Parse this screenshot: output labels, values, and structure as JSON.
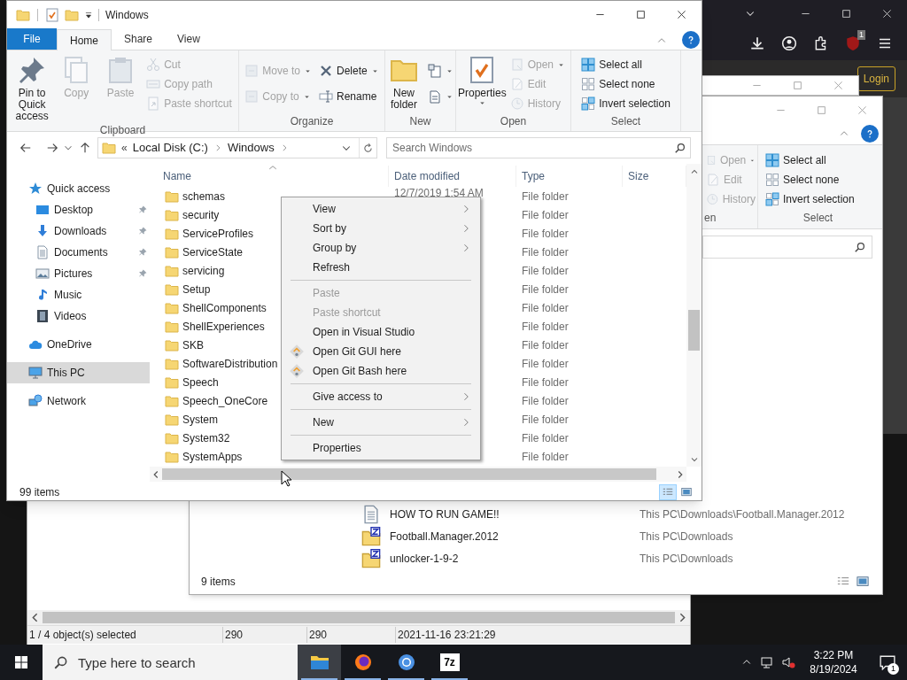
{
  "browser": {
    "login_button": "Login",
    "extension_badge": "1"
  },
  "back_window": {
    "status": [
      "1 / 4 object(s) selected",
      "290",
      "290",
      "2021-11-16 23:21:29"
    ]
  },
  "search_window": {
    "open_items": [
      {
        "label": "Open",
        "kind": "open",
        "disabled": true,
        "dropdown": true
      },
      {
        "label": "Edit",
        "kind": "edit",
        "disabled": true
      },
      {
        "label": "History",
        "kind": "history",
        "disabled": true
      }
    ],
    "group_labels": [
      "en",
      "Select"
    ],
    "select_items": [
      {
        "label": "Select all",
        "kind": "selectall"
      },
      {
        "label": "Select none",
        "kind": "selectnone"
      },
      {
        "label": "Invert selection",
        "kind": "invert"
      }
    ],
    "results": [
      {
        "name": "HOW TO RUN GAME!!",
        "location": "This PC\\Downloads\\Football.Manager.2012",
        "kind": "text"
      },
      {
        "name": "Football.Manager.2012",
        "location": "This PC\\Downloads",
        "kind": "archive"
      },
      {
        "name": "unlocker-1-9-2",
        "location": "This PC\\Downloads",
        "kind": "archive"
      }
    ],
    "status": "9 items"
  },
  "explorer": {
    "title": "Windows",
    "tabs": [
      {
        "label": "File",
        "kind": "file",
        "selected": false
      },
      {
        "label": "Home",
        "kind": "tab",
        "selected": true
      },
      {
        "label": "Share",
        "kind": "tab",
        "selected": false
      },
      {
        "label": "View",
        "kind": "tab",
        "selected": false
      }
    ],
    "ribbon": [
      {
        "label": "Clipboard",
        "columns": [
          {
            "kind": "large",
            "item": {
              "label": "Pin to Quick access",
              "kind": "pin",
              "disabled": false
            }
          },
          {
            "kind": "large",
            "item": {
              "label": "Copy",
              "kind": "copy",
              "disabled": true
            }
          },
          {
            "kind": "large",
            "item": {
              "label": "Paste",
              "kind": "paste",
              "disabled": true
            }
          },
          {
            "kind": "stack",
            "items": [
              {
                "label": "Cut",
                "kind": "cut",
                "disabled": true
              },
              {
                "label": "Copy path",
                "kind": "path",
                "disabled": true
              },
              {
                "label": "Paste shortcut",
                "kind": "shortcut",
                "disabled": true
              }
            ]
          }
        ]
      },
      {
        "label": "Organize",
        "columns": [
          {
            "kind": "stack",
            "items": [
              {
                "label": "Move to",
                "kind": "move",
                "disabled": true,
                "dropdown": true
              },
              {
                "label": "Copy to",
                "kind": "move",
                "disabled": true,
                "dropdown": true
              }
            ]
          },
          {
            "kind": "stack",
            "items": [
              {
                "label": "Delete",
                "kind": "delete",
                "disabled": false,
                "dropdown": true
              },
              {
                "label": "Rename",
                "kind": "rename",
                "disabled": false
              }
            ]
          }
        ]
      },
      {
        "label": "New",
        "columns": [
          {
            "kind": "large",
            "item": {
              "label": "New folder",
              "kind": "folder",
              "disabled": false
            }
          },
          {
            "kind": "stack",
            "items": [
              {
                "kind": "newitem",
                "disabled": false,
                "dropdown": true
              },
              {
                "kind": "easy",
                "disabled": false,
                "dropdown": true
              }
            ]
          }
        ]
      },
      {
        "label": "Open",
        "columns": [
          {
            "kind": "large",
            "item": {
              "label": "Properties",
              "kind": "properties",
              "disabled": false,
              "dropdown": true
            }
          },
          {
            "kind": "stack",
            "items": [
              {
                "label": "Open",
                "kind": "open",
                "disabled": true,
                "dropdown": true
              },
              {
                "label": "Edit",
                "kind": "edit",
                "disabled": true
              },
              {
                "label": "History",
                "kind": "history",
                "disabled": true
              }
            ]
          }
        ]
      },
      {
        "label": "Select",
        "columns": [
          {
            "kind": "stack",
            "items": [
              {
                "label": "Select all",
                "kind": "selectall",
                "disabled": false
              },
              {
                "label": "Select none",
                "kind": "selectnone",
                "disabled": false
              },
              {
                "label": "Invert selection",
                "kind": "invert",
                "disabled": false
              }
            ]
          }
        ]
      }
    ],
    "address": {
      "overflow": "«",
      "crumbs": [
        "Local Disk (C:)",
        "Windows"
      ]
    },
    "search": {
      "placeholder": "Search Windows"
    },
    "nav": [
      {
        "label": "Quick access",
        "kind": "star",
        "selected": false,
        "children": [
          {
            "label": "Desktop",
            "kind": "desktop",
            "pinned": true
          },
          {
            "label": "Downloads",
            "kind": "download",
            "pinned": true
          },
          {
            "label": "Documents",
            "kind": "document",
            "pinned": true
          },
          {
            "label": "Pictures",
            "kind": "picture",
            "pinned": true
          },
          {
            "label": "Music",
            "kind": "music",
            "pinned": false
          },
          {
            "label": "Videos",
            "kind": "video",
            "pinned": false
          }
        ]
      },
      {
        "label": "OneDrive",
        "kind": "cloud",
        "selected": false
      },
      {
        "label": "This PC",
        "kind": "pc",
        "selected": true
      },
      {
        "label": "Network",
        "kind": "network",
        "selected": false
      }
    ],
    "columns": [
      "Name",
      "Date modified",
      "Type",
      "Size"
    ],
    "rows": [
      {
        "name": "schemas",
        "date": "12/7/2019 1:54 AM",
        "type": "File folder"
      },
      {
        "name": "security",
        "type": "File folder"
      },
      {
        "name": "ServiceProfiles",
        "type": "File folder"
      },
      {
        "name": "ServiceState",
        "type": "File folder"
      },
      {
        "name": "servicing",
        "type": "File folder"
      },
      {
        "name": "Setup",
        "type": "File folder"
      },
      {
        "name": "ShellComponents",
        "type": "File folder"
      },
      {
        "name": "ShellExperiences",
        "type": "File folder"
      },
      {
        "name": "SKB",
        "type": "File folder"
      },
      {
        "name": "SoftwareDistribution",
        "type": "File folder"
      },
      {
        "name": "Speech",
        "type": "File folder"
      },
      {
        "name": "Speech_OneCore",
        "type": "File folder"
      },
      {
        "name": "System",
        "type": "File folder"
      },
      {
        "name": "System32",
        "type": "File folder"
      },
      {
        "name": "SystemApps",
        "type": "File folder"
      }
    ],
    "status": "99 items"
  },
  "context_menu": [
    {
      "kind": "item",
      "label": "View",
      "submenu": true,
      "disabled": false
    },
    {
      "kind": "item",
      "label": "Sort by",
      "submenu": true,
      "disabled": false
    },
    {
      "kind": "item",
      "label": "Group by",
      "submenu": true,
      "disabled": false
    },
    {
      "kind": "item",
      "label": "Refresh",
      "submenu": false,
      "disabled": false
    },
    {
      "kind": "separator"
    },
    {
      "kind": "item",
      "label": "Paste",
      "submenu": false,
      "disabled": true
    },
    {
      "kind": "item",
      "label": "Paste shortcut",
      "submenu": false,
      "disabled": true
    },
    {
      "kind": "item",
      "label": "Open in Visual Studio",
      "submenu": false,
      "disabled": false
    },
    {
      "kind": "git",
      "label": "Open Git GUI here",
      "submenu": false,
      "disabled": false
    },
    {
      "kind": "git",
      "label": "Open Git Bash here",
      "submenu": false,
      "disabled": false
    },
    {
      "kind": "separator"
    },
    {
      "kind": "item",
      "label": "Give access to",
      "submenu": true,
      "disabled": false
    },
    {
      "kind": "separator"
    },
    {
      "kind": "item",
      "label": "New",
      "submenu": true,
      "disabled": false
    },
    {
      "kind": "separator"
    },
    {
      "kind": "item",
      "label": "Properties",
      "submenu": false,
      "disabled": false
    }
  ],
  "taskbar": {
    "search_placeholder": "Type here to search",
    "apps": [
      {
        "kind": "folder",
        "selected": true
      },
      {
        "kind": "firefox",
        "selected": false
      },
      {
        "kind": "chrome",
        "selected": false
      },
      {
        "kind": "archiver",
        "label": "7z",
        "selected": false
      }
    ],
    "time": "3:22 PM",
    "date": "8/19/2024",
    "notifications": "1"
  }
}
